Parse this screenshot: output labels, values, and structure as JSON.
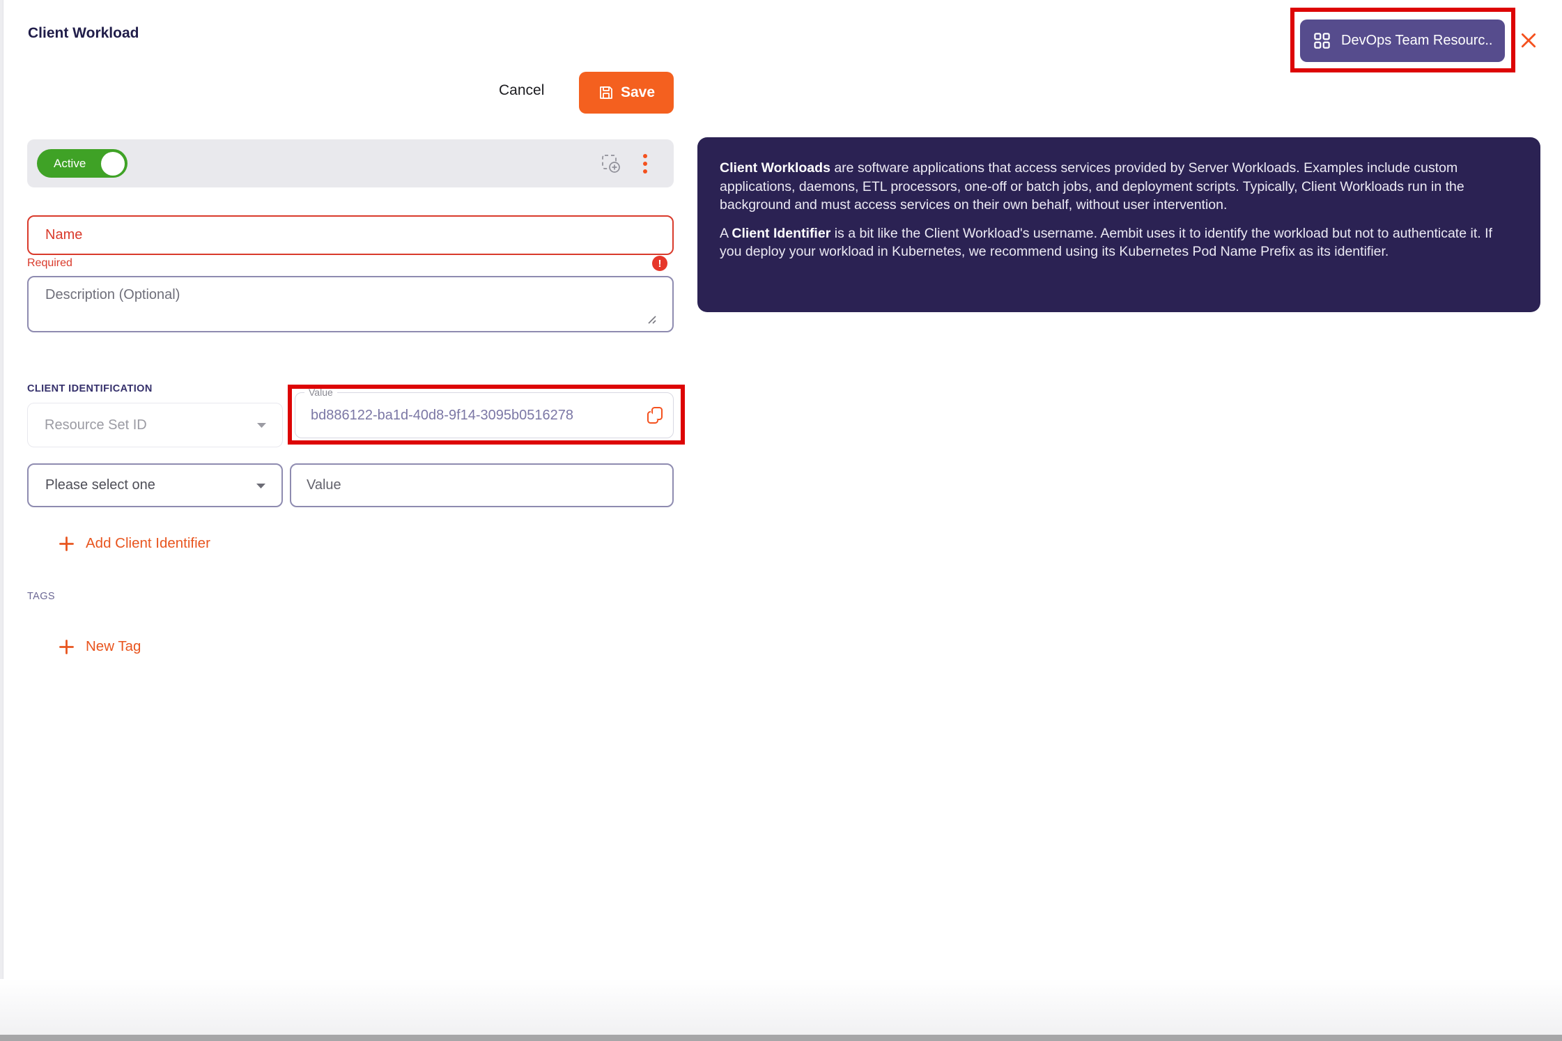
{
  "header": {
    "title": "Client Workload"
  },
  "top_right": {
    "resource_set_button_label": "DevOps Team Resourc...",
    "resource_set_button_icon": "grid-icon",
    "close_icon": "close-x-icon"
  },
  "actions": {
    "cancel_label": "Cancel",
    "save_label": "Save",
    "save_icon": "floppy-disk-icon"
  },
  "status_bar": {
    "toggle_label": "Active",
    "toggle_state": "on",
    "screenshot_icon": "add-to-set-icon",
    "menu_icon": "kebab-menu-icon"
  },
  "form": {
    "name": {
      "placeholder": "Name",
      "value": "",
      "error_text": "Required",
      "error_mark": "!"
    },
    "description": {
      "placeholder": "Description (Optional)",
      "value": ""
    },
    "client_identification": {
      "section_label": "CLIENT IDENTIFICATION",
      "resource_set_select": {
        "selected": "Resource Set ID",
        "disabled": true
      },
      "resource_set_value": {
        "float_label": "Value",
        "value": "bd886122-ba1d-40d8-9f14-3095b0516278",
        "copy_icon": "copy-icon"
      },
      "identifier_type_select": {
        "placeholder": "Please select one"
      },
      "identifier_value": {
        "placeholder": "Value",
        "value": ""
      },
      "add_identifier_label": "Add Client Identifier"
    },
    "tags": {
      "section_label": "TAGS",
      "new_tag_label": "New Tag"
    }
  },
  "info_panel": {
    "p1_bold": "Client Workloads",
    "p1_rest": " are software applications that access services provided by Server Workloads. Examples include custom applications, daemons, ETL processors, one-off or batch jobs, and deployment scripts. Typically, Client Workloads run in the background and must access services on their own behalf, without user intervention.",
    "p2_prefix": "A ",
    "p2_bold": "Client Identifier",
    "p2_rest": " is a bit like the Client Workload's username. Aembit uses it to identify the workload but not to authenticate it. If you deploy your workload in Kubernetes, we recommend using its Kubernetes Pod Name Prefix as its identifier."
  },
  "theme": {
    "accent_orange": "#f4601f",
    "annotation_red": "#dd0505",
    "panel_bg": "#2b2253",
    "resource_button_purple": "#564c8d",
    "toggle_green": "#3fa226",
    "error_red": "#d93a2b",
    "link_orange": "#e8551f"
  }
}
